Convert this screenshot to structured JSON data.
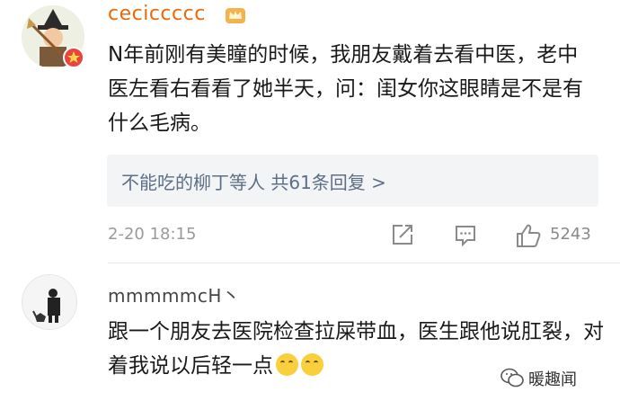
{
  "comment1": {
    "username": "ceciccccc",
    "text": "N年前刚有美瞳的时候，我朋友戴着去看中医，老中医左看右看看了她半天，问：闺女你这眼睛是不是有什么毛病。",
    "replies_label": "不能吃的柳丁等人  共61条回复 >",
    "time": "2-20 18:15",
    "likes": "5243"
  },
  "comment2": {
    "username": "mmmmmcH丶",
    "text": "跟一个朋友去医院检查拉屎带血，医生跟他说肛裂，对着我说以后轻一点"
  },
  "watermark": "暖趣闻",
  "colors": {
    "username_vip": "#e86a0c",
    "reply_link": "#5d6f86",
    "reply_bg": "#f3f4f6",
    "badge": "#e8453c"
  }
}
